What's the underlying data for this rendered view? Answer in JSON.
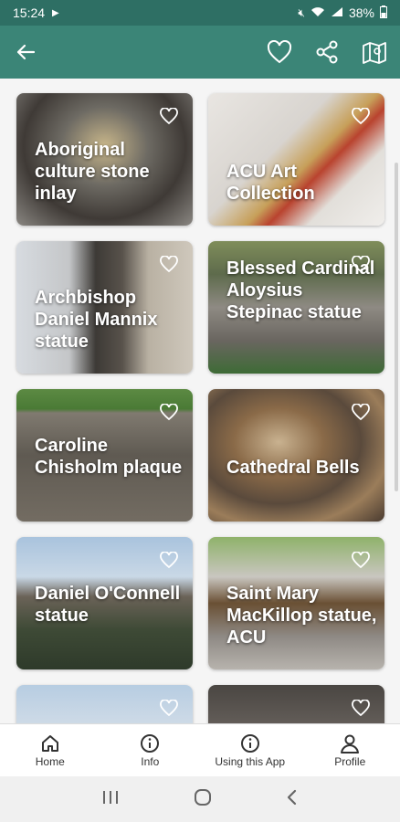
{
  "status": {
    "time": "15:24",
    "battery": "38%"
  },
  "app_bar": {
    "back_icon": "arrow-left-icon",
    "actions": [
      "heart-icon",
      "share-icon",
      "map-icon"
    ]
  },
  "cards": [
    {
      "title": "Aboriginal culture stone inlay"
    },
    {
      "title": "ACU Art Collection"
    },
    {
      "title": "Archbishop Daniel Mannix statue"
    },
    {
      "title": "Blessed Cardinal Aloysius Stepinac statue"
    },
    {
      "title": "Caroline Chisholm plaque"
    },
    {
      "title": "Cathedral Bells"
    },
    {
      "title": "Daniel O'Connell statue"
    },
    {
      "title": "Saint Mary MacKillop statue, ACU"
    },
    {
      "title": ""
    },
    {
      "title": ""
    }
  ],
  "bottom_nav": {
    "items": [
      {
        "label": "Home",
        "icon": "home-icon"
      },
      {
        "label": "Info",
        "icon": "info-icon"
      },
      {
        "label": "Using this App",
        "icon": "info-icon"
      },
      {
        "label": "Profile",
        "icon": "profile-icon"
      }
    ]
  },
  "colors": {
    "status_bar": "#2e6f64",
    "app_bar": "#3b8577"
  }
}
